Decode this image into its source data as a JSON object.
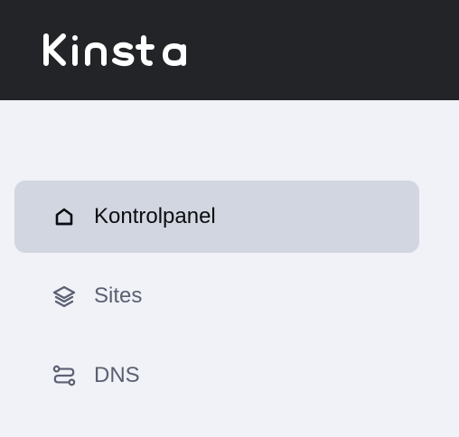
{
  "brand": {
    "name": "Kinsta",
    "logo_color": "#ffffff",
    "header_bg": "#232428"
  },
  "nav": {
    "items": [
      {
        "label": "Kontrolpanel",
        "icon": "home-icon",
        "active": true
      },
      {
        "label": "Sites",
        "icon": "layers-icon",
        "active": false
      },
      {
        "label": "DNS",
        "icon": "dns-route-icon",
        "active": false
      }
    ]
  },
  "colors": {
    "page_bg": "#f0f2f7",
    "active_bg": "#d1d6e0",
    "active_text": "#0c0d10",
    "inactive_text": "#5b6072"
  }
}
